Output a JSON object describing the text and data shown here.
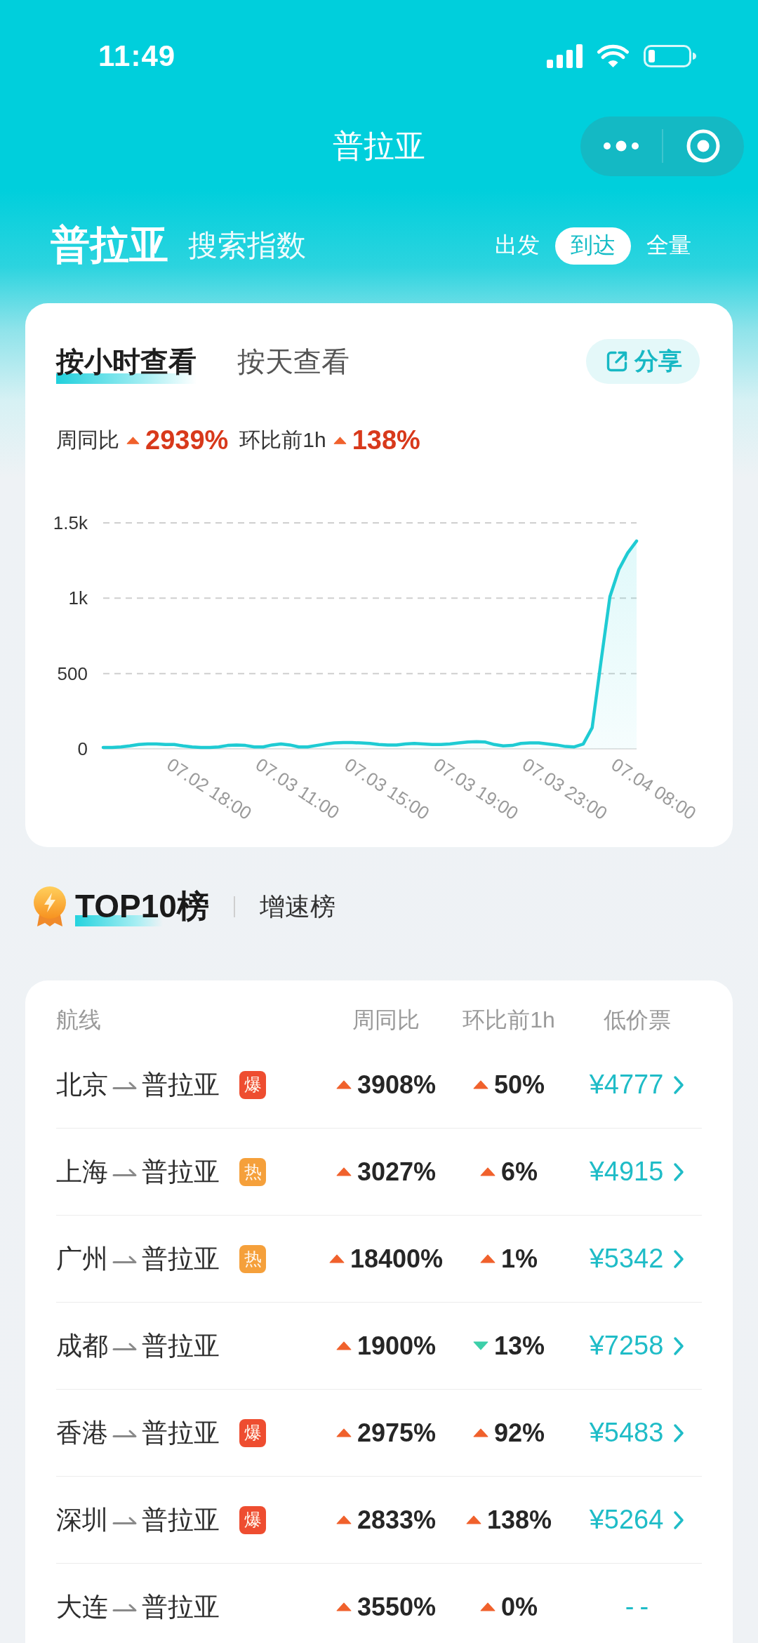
{
  "status_bar": {
    "time": "11:49"
  },
  "nav_bar": {
    "title": "普拉亚"
  },
  "header": {
    "title": "普拉亚",
    "subtitle": "搜索指数",
    "direction_tabs": [
      {
        "label": "出发",
        "selected": false
      },
      {
        "label": "到达",
        "selected": true
      },
      {
        "label": "全量",
        "selected": false
      }
    ]
  },
  "trend_card": {
    "tabs": [
      {
        "label": "按小时查看",
        "selected": true
      },
      {
        "label": "按天查看",
        "selected": false
      }
    ],
    "share_button": "分享",
    "stats": [
      {
        "label": "周同比",
        "rising": true,
        "value": "2939%"
      },
      {
        "label": "环比前1h",
        "rising": true,
        "value": "138%"
      }
    ],
    "chart_data": {
      "type": "area",
      "categories": [
        null,
        null,
        null,
        null,
        null,
        null,
        null,
        "07.02 18:00",
        null,
        null,
        null,
        null,
        null,
        null,
        null,
        null,
        null,
        "07.03 11:00",
        null,
        null,
        null,
        null,
        null,
        null,
        null,
        null,
        null,
        "07.03 15:00",
        null,
        null,
        null,
        null,
        null,
        null,
        null,
        null,
        null,
        "07.03 19:00",
        null,
        null,
        null,
        null,
        null,
        null,
        null,
        null,
        null,
        "07.03 23:00",
        null,
        null,
        null,
        null,
        null,
        null,
        null,
        null,
        null,
        "07.04 08:00",
        null,
        null,
        null
      ],
      "series": [
        {
          "color": "#1fcbd3",
          "values": [
            10,
            10,
            13,
            20,
            29,
            32,
            32,
            29,
            29,
            20,
            13,
            10,
            10,
            13,
            23,
            26,
            23,
            13,
            13,
            26,
            32,
            26,
            13,
            13,
            23,
            32,
            39,
            42,
            42,
            39,
            36,
            29,
            26,
            26,
            32,
            36,
            32,
            29,
            29,
            32,
            39,
            45,
            48,
            45,
            29,
            20,
            23,
            36,
            39,
            39,
            32,
            26,
            16,
            13,
            32,
            140,
            580,
            1010,
            1190,
            1300,
            1380
          ]
        }
      ],
      "ylim": [
        0,
        1500
      ],
      "yticks": [
        {
          "value": 0,
          "label": "0"
        },
        {
          "value": 500,
          "label": "500"
        },
        {
          "value": 1000,
          "label": "1k"
        },
        {
          "value": 1500,
          "label": "1.5k"
        }
      ]
    }
  },
  "ranking": {
    "tabs": [
      {
        "label": "TOP10榜",
        "selected": true
      },
      {
        "label": "增速榜",
        "selected": false
      }
    ],
    "table": {
      "columns": [
        "航线",
        "周同比",
        "环比前1h",
        "低价票"
      ],
      "rows": [
        {
          "from": "北京",
          "to": "普拉亚",
          "badge": {
            "label": "爆",
            "color": "#ee4d30"
          },
          "week_change": {
            "value": "3908%",
            "rising": true
          },
          "hour_change": {
            "value": "50%",
            "rising": true
          },
          "price": "¥4777",
          "link": true
        },
        {
          "from": "上海",
          "to": "普拉亚",
          "badge": {
            "label": "热",
            "color": "#f5a03b"
          },
          "week_change": {
            "value": "3027%",
            "rising": true
          },
          "hour_change": {
            "value": "6%",
            "rising": true
          },
          "price": "¥4915",
          "link": true
        },
        {
          "from": "广州",
          "to": "普拉亚",
          "badge": {
            "label": "热",
            "color": "#f5a03b"
          },
          "week_change": {
            "value": "18400%",
            "rising": true
          },
          "hour_change": {
            "value": "1%",
            "rising": true
          },
          "price": "¥5342",
          "link": true
        },
        {
          "from": "成都",
          "to": "普拉亚",
          "week_change": {
            "value": "1900%",
            "rising": true
          },
          "hour_change": {
            "value": "13%",
            "rising": false
          },
          "price": "¥7258",
          "link": true
        },
        {
          "from": "香港",
          "to": "普拉亚",
          "badge": {
            "label": "爆",
            "color": "#ee4d30"
          },
          "week_change": {
            "value": "2975%",
            "rising": true
          },
          "hour_change": {
            "value": "92%",
            "rising": true
          },
          "price": "¥5483",
          "link": true
        },
        {
          "from": "深圳",
          "to": "普拉亚",
          "badge": {
            "label": "爆",
            "color": "#ee4d30"
          },
          "week_change": {
            "value": "2833%",
            "rising": true
          },
          "hour_change": {
            "value": "138%",
            "rising": true
          },
          "price": "¥5264",
          "link": true
        },
        {
          "from": "大连",
          "to": "普拉亚",
          "week_change": {
            "value": "3550%",
            "rising": true
          },
          "hour_change": {
            "value": "0%",
            "rising": true
          },
          "price": "--",
          "link": false
        }
      ]
    }
  }
}
